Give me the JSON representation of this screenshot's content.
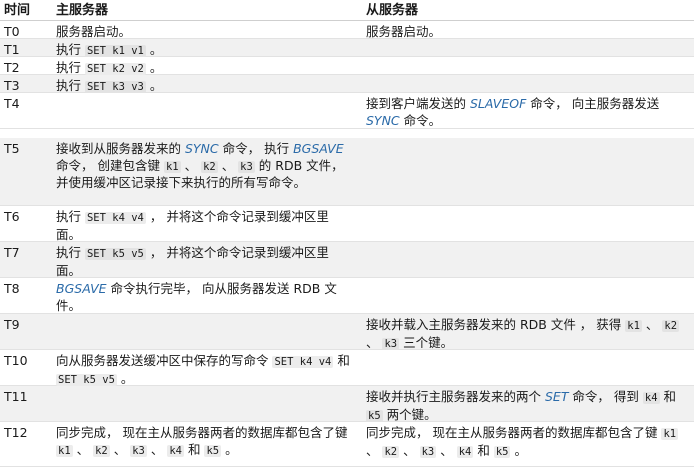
{
  "header": {
    "time": "时间",
    "master": "主服务器",
    "slave": "从服务器"
  },
  "rows": [
    {
      "time": "T0",
      "master": [
        {
          "t": "服务器启动。"
        }
      ],
      "slave": [
        {
          "t": "服务器启动。"
        }
      ]
    },
    {
      "time": "T1",
      "master": [
        {
          "t": "执行 "
        },
        {
          "c": "SET k1 v1"
        },
        {
          "t": " 。"
        }
      ],
      "slave": []
    },
    {
      "time": "T2",
      "master": [
        {
          "t": "执行 "
        },
        {
          "c": "SET k2 v2"
        },
        {
          "t": " 。"
        }
      ],
      "slave": []
    },
    {
      "time": "T3",
      "master": [
        {
          "t": "执行 "
        },
        {
          "c": "SET k3 v3"
        },
        {
          "t": " 。"
        }
      ],
      "slave": []
    },
    {
      "time": "T4",
      "master": [],
      "slave": [
        {
          "t": "接到客户端发送的 "
        },
        {
          "k": "SLAVEOF"
        },
        {
          "t": " 命令， 向主服务器发送 "
        },
        {
          "k": "SYNC"
        },
        {
          "t": " 命令。"
        }
      ]
    },
    {
      "time": "T5",
      "master": [
        {
          "t": "接收到从服务器发来的 "
        },
        {
          "k": "SYNC"
        },
        {
          "t": " 命令， 执行 "
        },
        {
          "k": "BGSAVE"
        },
        {
          "t": " 命令， 创建包含键 "
        },
        {
          "c": "k1"
        },
        {
          "t": " 、 "
        },
        {
          "c": "k2"
        },
        {
          "t": " 、 "
        },
        {
          "c": "k3"
        },
        {
          "t": " 的 RDB 文件， 并使用缓冲区记录接下来执行的所有写命令。"
        }
      ],
      "slave": []
    },
    {
      "time": "T6",
      "master": [
        {
          "t": "执行 "
        },
        {
          "c": "SET k4 v4"
        },
        {
          "t": " ， 并将这个命令记录到缓冲区里面。"
        }
      ],
      "slave": []
    },
    {
      "time": "T7",
      "master": [
        {
          "t": "执行 "
        },
        {
          "c": "SET k5 v5"
        },
        {
          "t": " ， 并将这个命令记录到缓冲区里面。"
        }
      ],
      "slave": []
    },
    {
      "time": "T8",
      "master": [
        {
          "k": "BGSAVE"
        },
        {
          "t": " 命令执行完毕， 向从服务器发送 RDB 文件。"
        }
      ],
      "slave": []
    },
    {
      "time": "T9",
      "master": [],
      "slave": [
        {
          "t": "接收并载入主服务器发来的 RDB 文件 ， 获得 "
        },
        {
          "c": "k1"
        },
        {
          "t": " 、 "
        },
        {
          "c": "k2"
        },
        {
          "t": " 、 "
        },
        {
          "c": "k3"
        },
        {
          "t": " 三个键。"
        }
      ]
    },
    {
      "time": "T10",
      "master": [
        {
          "t": "向从服务器发送缓冲区中保存的写命令 "
        },
        {
          "c": "SET k4 v4"
        },
        {
          "t": " 和 "
        },
        {
          "c": "SET k5 v5"
        },
        {
          "t": " 。"
        }
      ],
      "slave": []
    },
    {
      "time": "T11",
      "master": [],
      "slave": [
        {
          "t": "接收并执行主服务器发来的两个 "
        },
        {
          "k": "SET"
        },
        {
          "t": " 命令， 得到 "
        },
        {
          "c": "k4"
        },
        {
          "t": " 和 "
        },
        {
          "c": "k5"
        },
        {
          "t": " 两个键。"
        }
      ]
    },
    {
      "time": "T12",
      "master": [
        {
          "t": "同步完成， 现在主从服务器两者的数据库都包含了键 "
        },
        {
          "c": "k1"
        },
        {
          "t": " 、 "
        },
        {
          "c": "k2"
        },
        {
          "t": " 、 "
        },
        {
          "c": "k3"
        },
        {
          "t": " 、 "
        },
        {
          "c": "k4"
        },
        {
          "t": " 和 "
        },
        {
          "c": "k5"
        },
        {
          "t": " 。"
        }
      ],
      "slave": [
        {
          "t": "同步完成， 现在主从服务器两者的数据库都包含了键 "
        },
        {
          "c": "k1"
        },
        {
          "t": " 、 "
        },
        {
          "c": "k2"
        },
        {
          "t": " 、 "
        },
        {
          "c": "k3"
        },
        {
          "t": " 、 "
        },
        {
          "c": "k4"
        },
        {
          "t": " 和 "
        },
        {
          "c": "k5"
        },
        {
          "t": " 。"
        }
      ]
    }
  ]
}
